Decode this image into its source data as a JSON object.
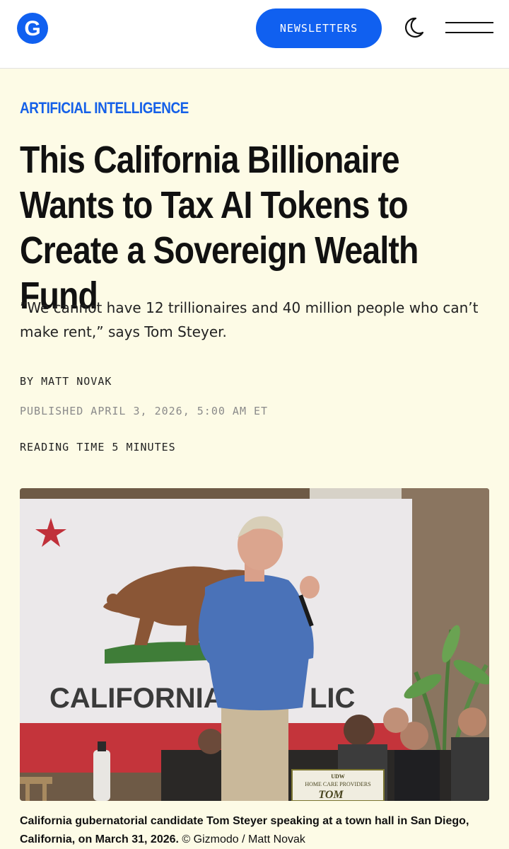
{
  "header": {
    "logo_letter": "G",
    "newsletters_label": "NEWSLETTERS",
    "brand_color": "#1060f0"
  },
  "article": {
    "category": "ARTIFICIAL INTELLIGENCE",
    "title": "This California Billionaire Wants to Tax AI Tokens to Create a Sovereign Wealth Fund",
    "subtitle": "”We cannot have 12 trillionaires and 40 million people who can’t make rent,” says Tom Steyer.",
    "byline": "BY MATT NOVAK",
    "published": "PUBLISHED APRIL 3, 2026, 5:00 AM ET",
    "reading_time": "READING TIME 5 MINUTES"
  },
  "hero": {
    "flag_text_left": "CALIFORNIA",
    "flag_text_right": "LIC",
    "sign_line1": "UDW",
    "sign_line2": "HOME CARE PROVIDERS",
    "sign_line3": "TOM",
    "caption_bold": "California gubernatorial candidate Tom Steyer speaking at a town hall in San Diego, California, on March 31, 2026.",
    "caption_credit": "© Gizmodo / Matt Novak"
  }
}
